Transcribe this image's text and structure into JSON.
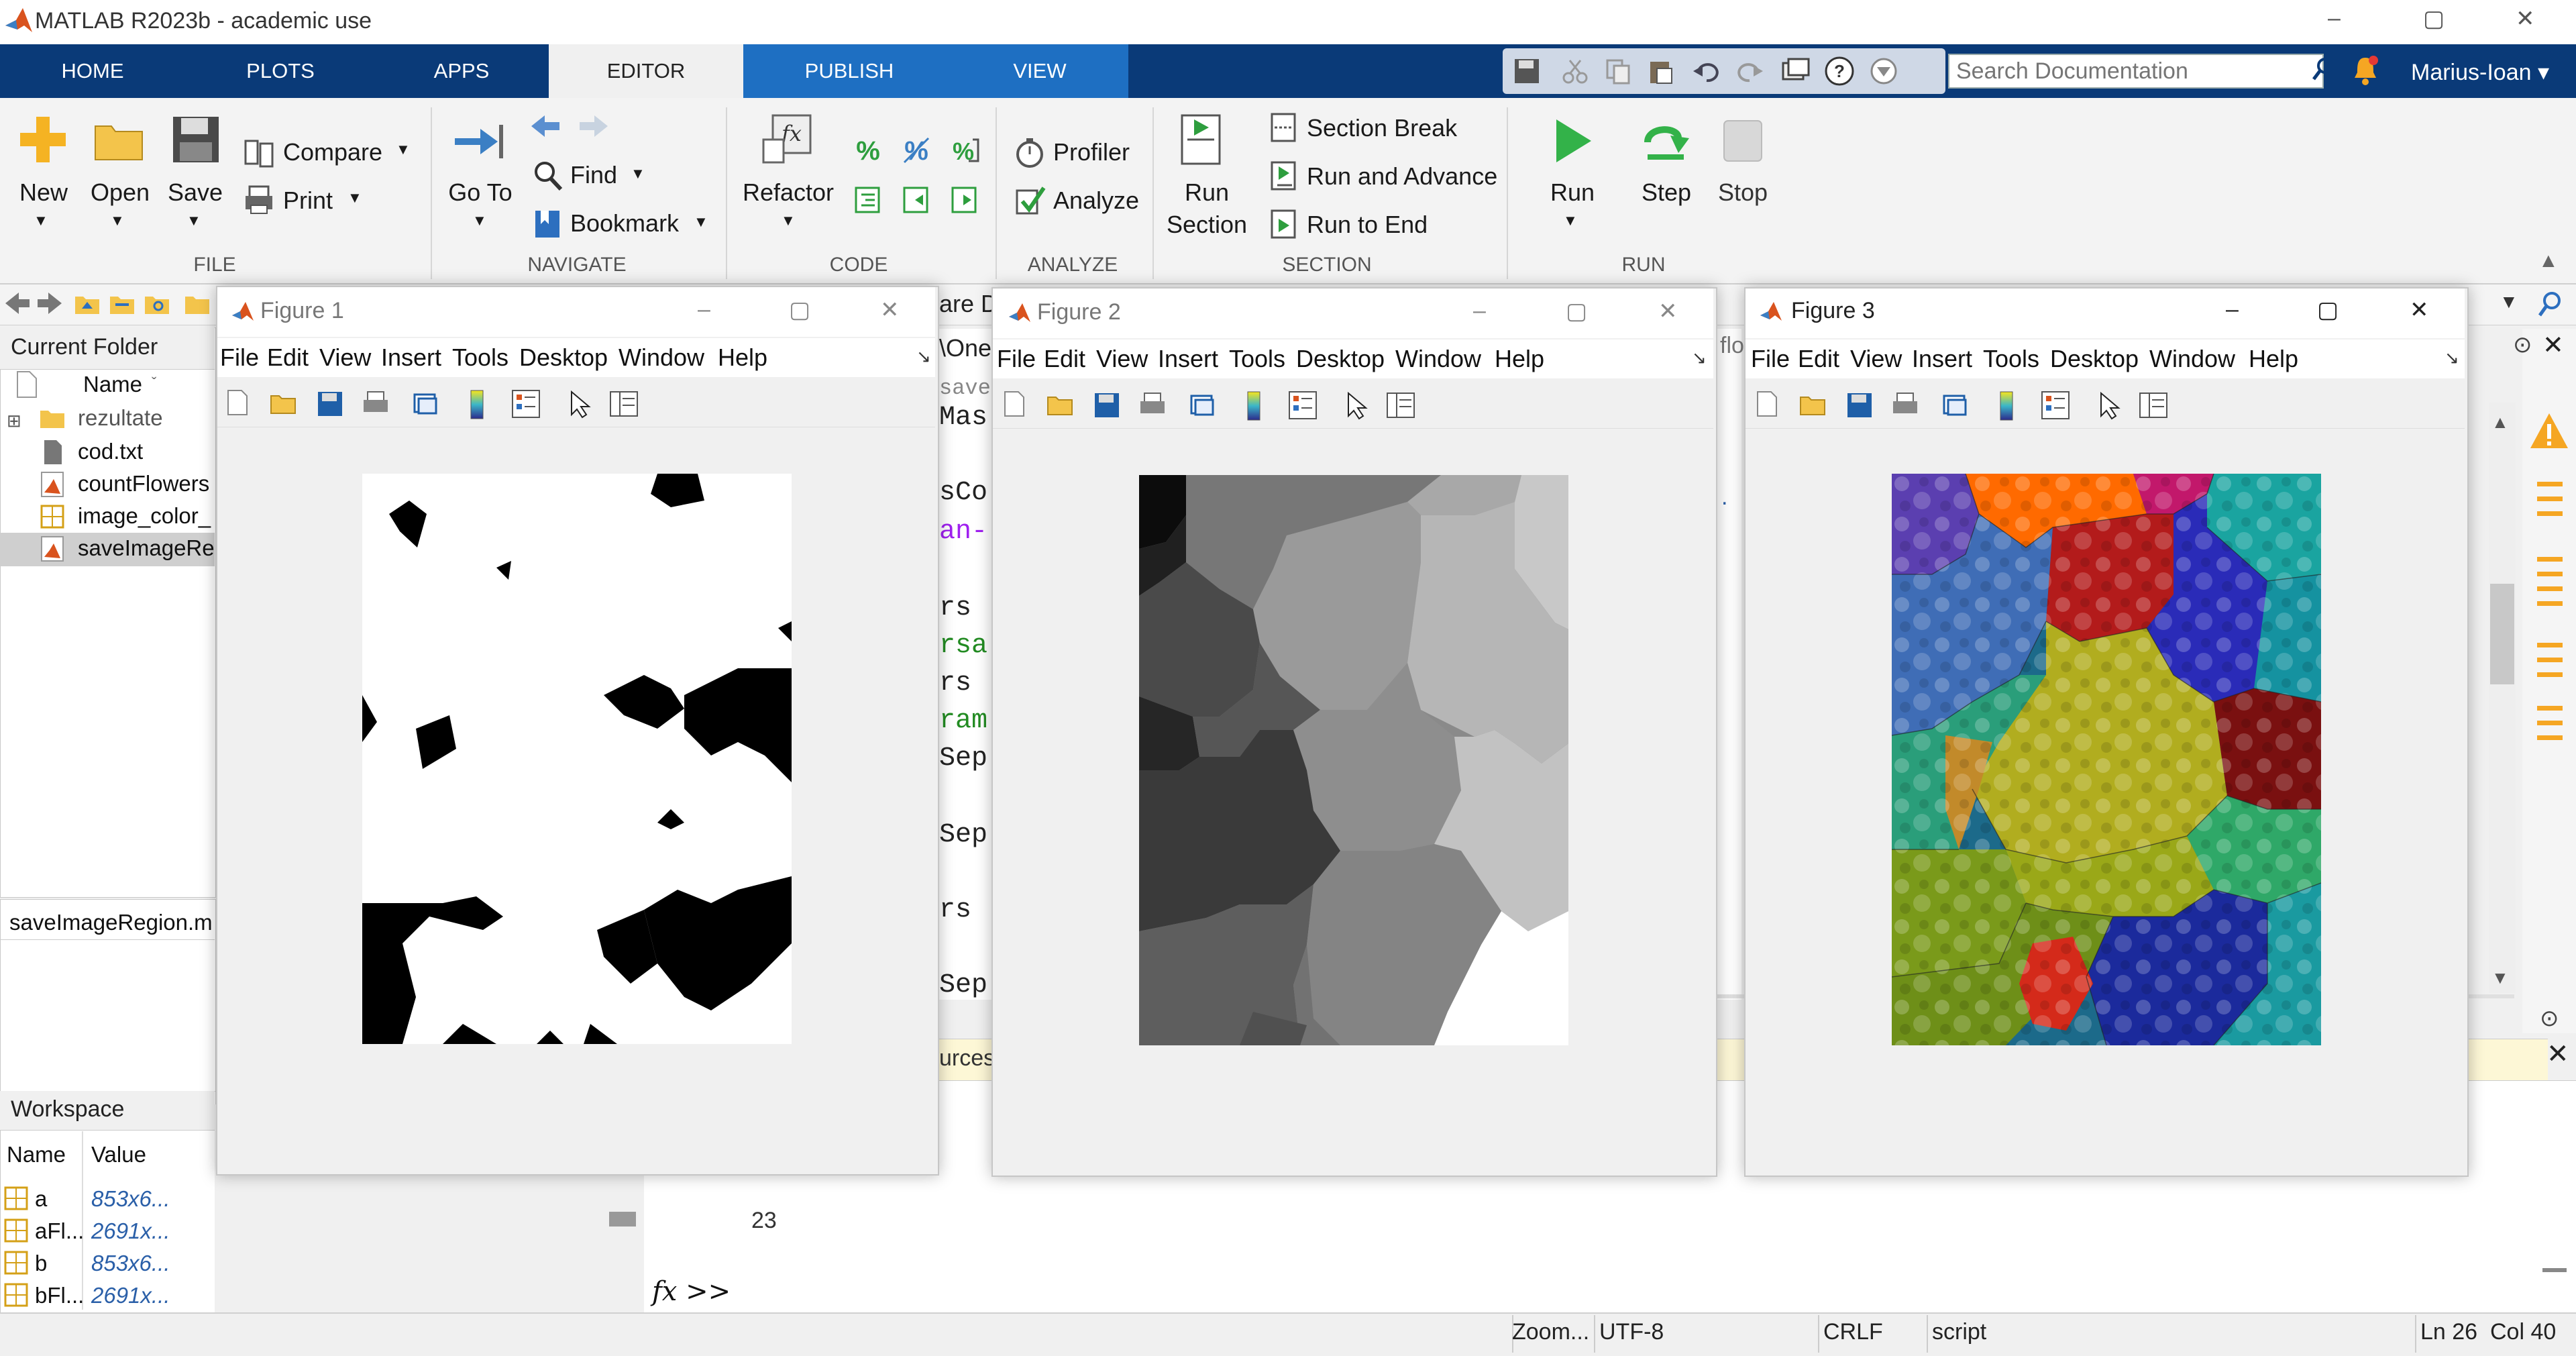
{
  "window": {
    "title": "MATLAB R2023b - academic use",
    "minimize": "–",
    "maximize": "▢",
    "close": "✕"
  },
  "tabs": [
    "HOME",
    "PLOTS",
    "APPS",
    "EDITOR",
    "PUBLISH",
    "VIEW"
  ],
  "search": {
    "placeholder": "Search Documentation"
  },
  "user": "Marius-Ioan ▾",
  "ribbon": {
    "file": {
      "new": "New",
      "open": "Open",
      "save": "Save",
      "compare": "Compare",
      "print": "Print",
      "group": "FILE"
    },
    "navigate": {
      "goto_line1": "Go To",
      "find": "Find",
      "bookmark": "Bookmark",
      "group": "NAVIGATE"
    },
    "code": {
      "refactor": "Refactor",
      "group": "CODE"
    },
    "analyze": {
      "profiler": "Profiler",
      "analyze": "Analyze",
      "group": "ANALYZE"
    },
    "section": {
      "run_section_1": "Run",
      "run_section_2": "Section",
      "section_break": "Section Break",
      "run_advance": "Run and Advance",
      "run_end": "Run to End",
      "group": "SECTION"
    },
    "run": {
      "run": "Run",
      "step": "Step",
      "stop": "Stop",
      "group": "RUN"
    }
  },
  "current_folder": {
    "title": "Current Folder",
    "col_name": "Name",
    "items": [
      "rezultate",
      "cod.txt",
      "countFlowers",
      "image_color_",
      "saveImageRe"
    ],
    "details": "saveImageRegion.m"
  },
  "workspace": {
    "title": "Workspace",
    "col_name": "Name",
    "col_value": "Value",
    "rows": [
      {
        "name": "a",
        "value": "853x6..."
      },
      {
        "name": "aFl...",
        "value": "2691x..."
      },
      {
        "name": "b",
        "value": "853x6..."
      },
      {
        "name": "bFl...",
        "value": "2691x..."
      }
    ]
  },
  "editor_fragments": {
    "tab_fragment": "are D",
    "path_fragment": "\\One",
    "lines": [
      "save",
      "Mas",
      "sCo",
      "an-",
      "rs",
      "rsa",
      "rs",
      "ram",
      "Sep",
      "Sep",
      "rs",
      "Sep"
    ],
    "line_number": "23",
    "fragment_right": "flo",
    "status_fragment": "urces"
  },
  "command": {
    "prompt": "fx >>"
  },
  "figures": [
    {
      "title": "Figure 1"
    },
    {
      "title": "Figure 2"
    },
    {
      "title": "Figure 3"
    }
  ],
  "figure_menu": [
    "File",
    "Edit",
    "View",
    "Insert",
    "Tools",
    "Desktop",
    "Window",
    "Help"
  ],
  "statusbar": {
    "zoom": "Zoom...",
    "encoding": "UTF-8",
    "eol": "CRLF",
    "type": "script",
    "position": "Ln 26  Col 40"
  }
}
